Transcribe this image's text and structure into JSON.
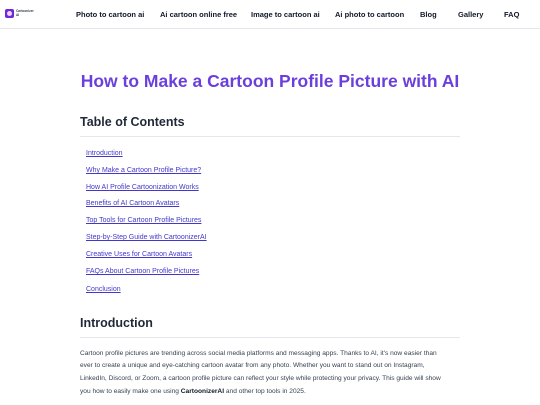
{
  "nav": {
    "logo_text": "Cartoonizer AI",
    "links": [
      "Photo to cartoon ai",
      "Ai cartoon online free",
      "Image to cartoon ai",
      "Ai photo to cartoon",
      "Blog",
      "Gallery",
      "FAQ"
    ]
  },
  "page": {
    "title": "How to Make a Cartoon Profile Picture with AI"
  },
  "toc": {
    "heading": "Table of Contents",
    "items": [
      "Introduction",
      "Why Make a Cartoon Profile Picture?",
      "How AI Profile Cartoonization Works",
      "Benefits of AI Cartoon Avatars",
      "Top Tools for Cartoon Profile Pictures",
      "Step-by-Step Guide with CartoonizerAI",
      "Creative Uses for Cartoon Avatars",
      "FAQs About Cartoon Profile Pictures",
      "Conclusion"
    ]
  },
  "intro": {
    "heading": "Introduction",
    "line1": "Cartoon profile pictures are trending across social media platforms and messaging apps. Thanks to AI, it's now easier than",
    "line2": "ever to create a unique and eye-catching cartoon avatar from any photo. Whether you want to stand out on Instagram,",
    "line3": "LinkedIn, Discord, or Zoom, a cartoon profile picture can reflect your style while protecting your privacy. This guide will show",
    "line4_a": "you how to easily make one using ",
    "line4_b": "CartoonizerAI",
    "line4_c": " and other top tools in 2025."
  },
  "colors": {
    "accent": "#6b3fdc",
    "link": "#4338ca"
  }
}
